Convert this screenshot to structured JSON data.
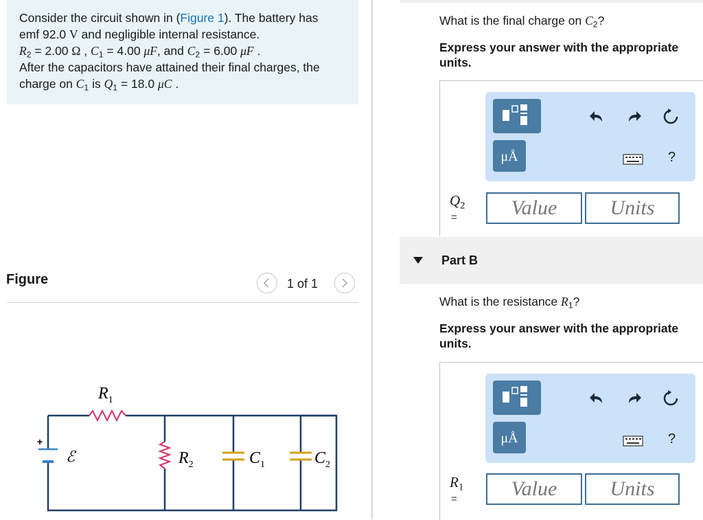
{
  "problem": {
    "line1_a": "Consider the circuit shown in (",
    "figure_link": "Figure 1",
    "line1_b": "). The battery has",
    "line2_a": "emf 92.0",
    "unit_V": "V",
    "line2_b": "and negligible internal resistance.",
    "R2_sym": "R",
    "R2_sub": "2",
    "R2_val": " = 2.00",
    "unit_ohm": "Ω",
    "C1_sym": "C",
    "C1_sub": "1",
    "C1_val": " = 4.00",
    "unit_uF1": "μF",
    "and_text": ", and",
    "C2_sym": "C",
    "C2_sub": "2",
    "C2_val": " = 6.00",
    "unit_uF2": "μF",
    "line4": "After the capacitors have attained their final charges, the",
    "line5_a": "charge on",
    "C1b_sym": "C",
    "C1b_sub": "1",
    "is_text": "is",
    "Q1_sym": "Q",
    "Q1_sub": "1",
    "Q1_val": " = 18.0",
    "unit_uC": "μC"
  },
  "figure": {
    "label": "Figure",
    "counter": "1 of 1",
    "circuit_labels": {
      "R1": "R",
      "R1_sub": "1",
      "emf": "ℰ",
      "R2": "R",
      "R2_sub": "2",
      "C1": "C",
      "C1_sub": "1",
      "C2": "C",
      "C2_sub": "2",
      "plus": "+"
    }
  },
  "partA": {
    "question_a": "What is the final charge on",
    "question_sym": "C",
    "question_sub": "2",
    "question_b": "?",
    "instruction": "Express your answer with the appropriate units.",
    "answer_sym": "Q",
    "answer_sub": "2",
    "eq": "=",
    "value_placeholder": "Value",
    "units_placeholder": "Units",
    "unit_btn_label": "μÅ",
    "help_label": "?"
  },
  "partB": {
    "title": "Part B",
    "question_a": "What is the resistance",
    "question_sym": "R",
    "question_sub": "1",
    "question_b": "?",
    "instruction": "Express your answer with the appropriate units.",
    "answer_sym": "R",
    "answer_sub": "1",
    "eq": "=",
    "value_placeholder": "Value",
    "units_placeholder": "Units",
    "unit_btn_label": "μÅ",
    "help_label": "?"
  },
  "colors": {
    "problem_bg": "#e8f4f6",
    "link": "#1d72b8",
    "toolbar_bg": "#cbe2f8",
    "tool_button": "#4a7ca4",
    "input_border": "#3d6f98",
    "circuit_wire": "#1f3f66",
    "resistor": "#d6336c",
    "capacitor": "#d4a017"
  },
  "icons": [
    "chevron-left-icon",
    "chevron-right-icon",
    "template-icon",
    "undo-icon",
    "redo-icon",
    "reset-icon",
    "keyboard-icon",
    "triangle-down-icon"
  ]
}
